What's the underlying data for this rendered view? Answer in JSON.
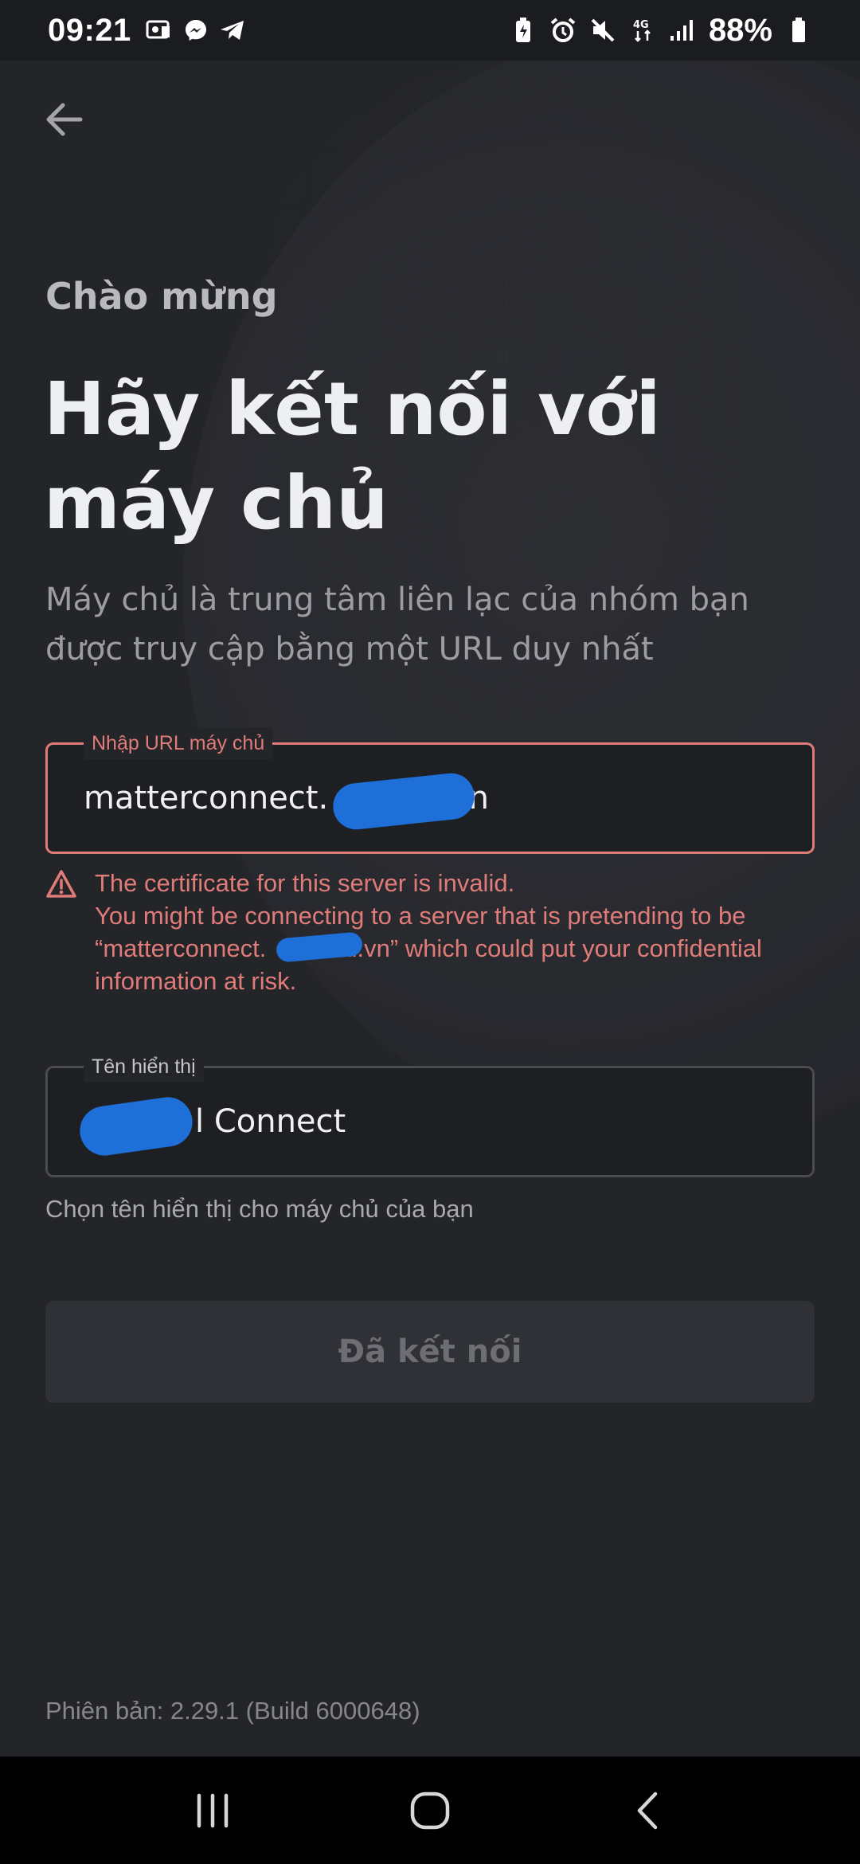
{
  "status_bar": {
    "time": "09:21",
    "battery": "88%",
    "network": "4G"
  },
  "screen": {
    "welcome": "Chào mừng",
    "heading_line1": "Hãy kết nối với",
    "heading_line2": "máy chủ",
    "subtitle": "Máy chủ là trung tâm liên lạc của nhóm bạn được truy cập bằng một URL duy nhất"
  },
  "url_field": {
    "label": "Nhập URL máy chủ",
    "value_prefix": "matterconnect.",
    "value_suffix": ".vn"
  },
  "error": {
    "line1": "The certificate for this server is invalid.",
    "line2": "You might be connecting to a server that is pretending to be",
    "line3_prefix": "“matterconnect.",
    "line3_suffix": "al.vn” which could put your confidential",
    "line4": "information at risk."
  },
  "name_field": {
    "label": "Tên hiển thị",
    "value_suffix": "l Connect"
  },
  "helper": "Chọn tên hiển thị cho máy chủ của bạn",
  "connect_button": "Đã kết nối",
  "version": "Phiên bản: 2.29.1 (Build 6000648)",
  "colors": {
    "background": "#242529",
    "error": "#df7b78",
    "redaction": "#1f6fd9"
  }
}
